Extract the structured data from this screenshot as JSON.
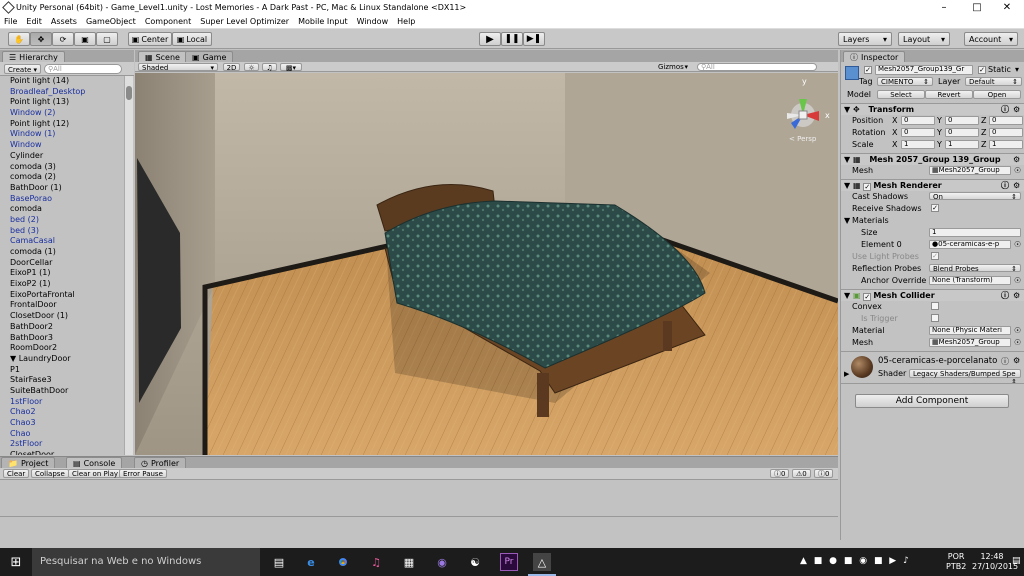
{
  "title_bar": {
    "title": "Unity Personal (64bit) - Game_Level1.unity - Lost Memories - A Dark Past - PC, Mac & Linux Standalone <DX11>"
  },
  "menu": [
    "File",
    "Edit",
    "Assets",
    "GameObject",
    "Component",
    "Super Level Optimizer",
    "Mobile Input",
    "Window",
    "Help"
  ],
  "toolbar": {
    "center": "Center",
    "local": "Local",
    "layers": "Layers",
    "layout": "Layout",
    "account": "Account"
  },
  "hierarchy": {
    "tab": "Hierarchy",
    "create": "Create",
    "search_placeholder": "All",
    "items": [
      {
        "label": "Point light (14)",
        "color": "black"
      },
      {
        "label": "Broadleaf_Desktop",
        "color": "blue"
      },
      {
        "label": "Point light (13)",
        "color": "black"
      },
      {
        "label": "Window (2)",
        "color": "blue"
      },
      {
        "label": "Point light (12)",
        "color": "black"
      },
      {
        "label": "Window (1)",
        "color": "blue"
      },
      {
        "label": "Window",
        "color": "blue"
      },
      {
        "label": "Cylinder",
        "color": "black"
      },
      {
        "label": "comoda (3)",
        "color": "black"
      },
      {
        "label": "comoda (2)",
        "color": "black"
      },
      {
        "label": "BathDoor (1)",
        "color": "black"
      },
      {
        "label": "BasePorao",
        "color": "blue"
      },
      {
        "label": "comoda",
        "color": "black"
      },
      {
        "label": "bed (2)",
        "color": "blue"
      },
      {
        "label": "bed (3)",
        "color": "blue"
      },
      {
        "label": "CamaCasal",
        "color": "blue"
      },
      {
        "label": "comoda (1)",
        "color": "black"
      },
      {
        "label": "DoorCellar",
        "color": "black"
      },
      {
        "label": "EixoP1 (1)",
        "color": "black"
      },
      {
        "label": "EixoP2 (1)",
        "color": "black"
      },
      {
        "label": "EixoPortaFrontal",
        "color": "black"
      },
      {
        "label": "FrontalDoor",
        "color": "black"
      },
      {
        "label": "ClosetDoor (1)",
        "color": "black"
      },
      {
        "label": "BathDoor2",
        "color": "black"
      },
      {
        "label": "BathDoor3",
        "color": "black"
      },
      {
        "label": "RoomDoor2",
        "color": "black"
      },
      {
        "label": "▼ LaundryDoor",
        "color": "black"
      },
      {
        "label": "   P1",
        "color": "black"
      },
      {
        "label": "StairFase3",
        "color": "black"
      },
      {
        "label": "SuiteBathDoor",
        "color": "black"
      },
      {
        "label": "1stFloor",
        "color": "blue"
      },
      {
        "label": "Chao2",
        "color": "blue"
      },
      {
        "label": "Chao3",
        "color": "blue"
      },
      {
        "label": "Chao",
        "color": "blue"
      },
      {
        "label": "2stFloor",
        "color": "blue"
      },
      {
        "label": "ClosetDoor",
        "color": "black"
      }
    ]
  },
  "scene": {
    "tab_scene": "Scene",
    "tab_game": "Game",
    "shading": "Shaded",
    "mode_2d": "2D",
    "gizmos": "Gizmos",
    "search_placeholder": "All",
    "persp": "Persp",
    "gizmo_y": "y",
    "gizmo_x": "x"
  },
  "inspector": {
    "tab": "Inspector",
    "object_name": "Mesh2057_Group139_Gr",
    "static": "Static",
    "tag_label": "Tag",
    "tag_value": "CIMENTO",
    "layer_label": "Layer",
    "layer_value": "Default",
    "model_label": "Model",
    "model_select": "Select",
    "model_revert": "Revert",
    "model_open": "Open",
    "transform": {
      "title": "Transform",
      "position": {
        "label": "Position",
        "x": "0",
        "y": "0",
        "z": "0"
      },
      "rotation": {
        "label": "Rotation",
        "x": "0",
        "y": "0",
        "z": "0"
      },
      "scale": {
        "label": "Scale",
        "x": "1",
        "y": "1",
        "z": "1"
      }
    },
    "mesh_filter": {
      "title": "Mesh 2057_Group 139_Group",
      "mesh_label": "Mesh",
      "mesh_value": "Mesh2057_Group"
    },
    "mesh_renderer": {
      "title": "Mesh Renderer",
      "cast_shadows_label": "Cast Shadows",
      "cast_shadows_value": "On",
      "receive_shadows_label": "Receive Shadows",
      "materials_label": "Materials",
      "size_label": "Size",
      "size_value": "1",
      "element0_label": "Element 0",
      "element0_value": "05-ceramicas-e-p",
      "light_probes_label": "Use Light Probes",
      "reflection_probes_label": "Reflection Probes",
      "reflection_probes_value": "Blend Probes",
      "anchor_override_label": "Anchor Override",
      "anchor_override_value": "None (Transform)"
    },
    "mesh_collider": {
      "title": "Mesh Collider",
      "convex_label": "Convex",
      "is_trigger_label": "Is Trigger",
      "material_label": "Material",
      "material_value": "None (Physic Materi",
      "mesh_label": "Mesh",
      "mesh_value": "Mesh2057_Group"
    },
    "material": {
      "name": "05-ceramicas-e-porcelanato",
      "shader_label": "Shader",
      "shader_value": "Legacy Shaders/Bumped Spe"
    },
    "add_component": "Add Component"
  },
  "console": {
    "tab_project": "Project",
    "tab_console": "Console",
    "tab_profiler": "Profiler",
    "buttons": [
      "Clear",
      "Collapse",
      "Clear on Play",
      "Error Pause"
    ],
    "count_info": "0",
    "count_warn": "0",
    "count_error": "0"
  },
  "taskbar": {
    "search_placeholder": "Pesquisar na Web e no Windows",
    "lang1": "POR",
    "lang2": "PTB2",
    "time": "12:48",
    "date": "27/10/2015"
  }
}
